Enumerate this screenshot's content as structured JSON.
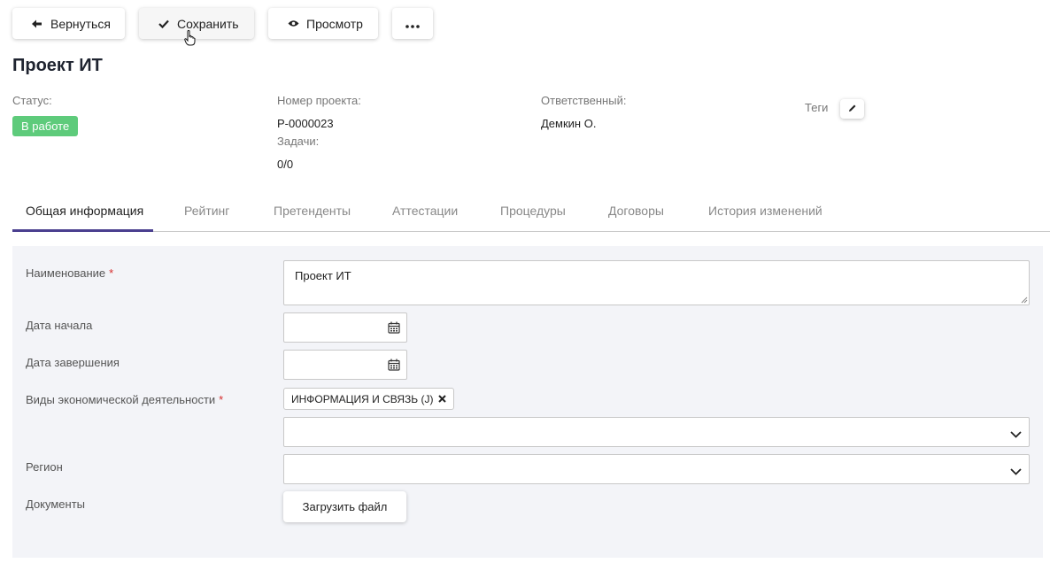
{
  "toolbar": {
    "back_label": "Вернуться",
    "save_label": "Сохранить",
    "preview_label": "Просмотр",
    "more_label": "•••"
  },
  "project": {
    "title": "Проект ИТ",
    "status_label": "Статус:",
    "status_value": "В работе",
    "number_label": "Номер проекта:",
    "number_value": "Р-0000023",
    "tasks_label": "Задачи:",
    "tasks_value": "0/0",
    "owner_label": "Ответственный:",
    "owner_value": "Демкин О.",
    "tags_label": "Теги"
  },
  "tabs": [
    {
      "label": "Общая информация",
      "active": true
    },
    {
      "label": "Рейтинг"
    },
    {
      "label": "Претенденты"
    },
    {
      "label": "Аттестации"
    },
    {
      "label": "Процедуры"
    },
    {
      "label": "Договоры"
    },
    {
      "label": "История изменений"
    }
  ],
  "form": {
    "name_label": "Наименование",
    "name_value": "Проект ИТ",
    "start_label": "Дата начала",
    "start_value": "",
    "end_label": "Дата завершения",
    "end_value": "",
    "activity_label": "Виды экономической деятельности",
    "activity_chip": "ИНФОРМАЦИЯ И СВЯЗЬ (J)",
    "activity_select_value": "",
    "region_label": "Регион",
    "region_value": "",
    "documents_label": "Документы",
    "upload_label": "Загрузить файл",
    "required_mark": "*"
  },
  "colors": {
    "status_badge": "#5ecb7b",
    "tab_underline": "#4a3f8f",
    "required": "#d62d2d",
    "panel_bg": "#f3f4f8"
  },
  "icons": {
    "back": "arrow-left-icon",
    "save": "check-icon",
    "preview": "eye-icon",
    "more": "more-horizontal-icon",
    "tag_edit": "pencil-icon",
    "calendar": "calendar-icon",
    "remove_chip": "close-icon",
    "dropdown": "chevron-down-icon"
  }
}
